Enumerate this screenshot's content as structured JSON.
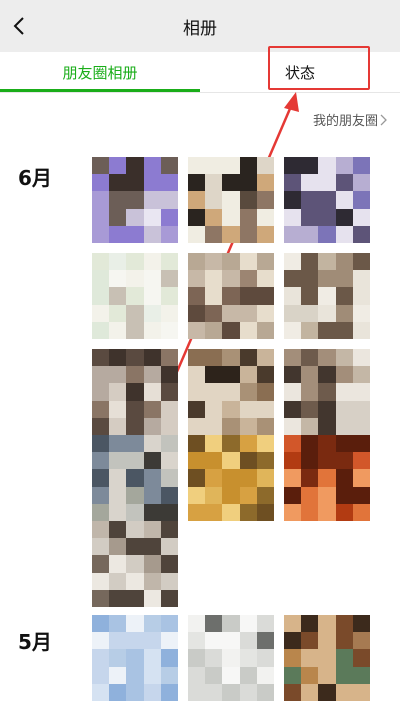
{
  "header": {
    "title": "相册",
    "back_icon": "back-chevron-icon"
  },
  "tabs": [
    {
      "label": "朋友圈相册",
      "active": true
    },
    {
      "label": "状态",
      "active": false
    }
  ],
  "moments_link": {
    "label": "我的朋友圈",
    "icon": "chevron-right-icon"
  },
  "sections": [
    {
      "month": "6月"
    },
    {
      "month": "5月"
    }
  ],
  "colors": {
    "accent": "#1aad19",
    "annotation": "#e53935"
  }
}
